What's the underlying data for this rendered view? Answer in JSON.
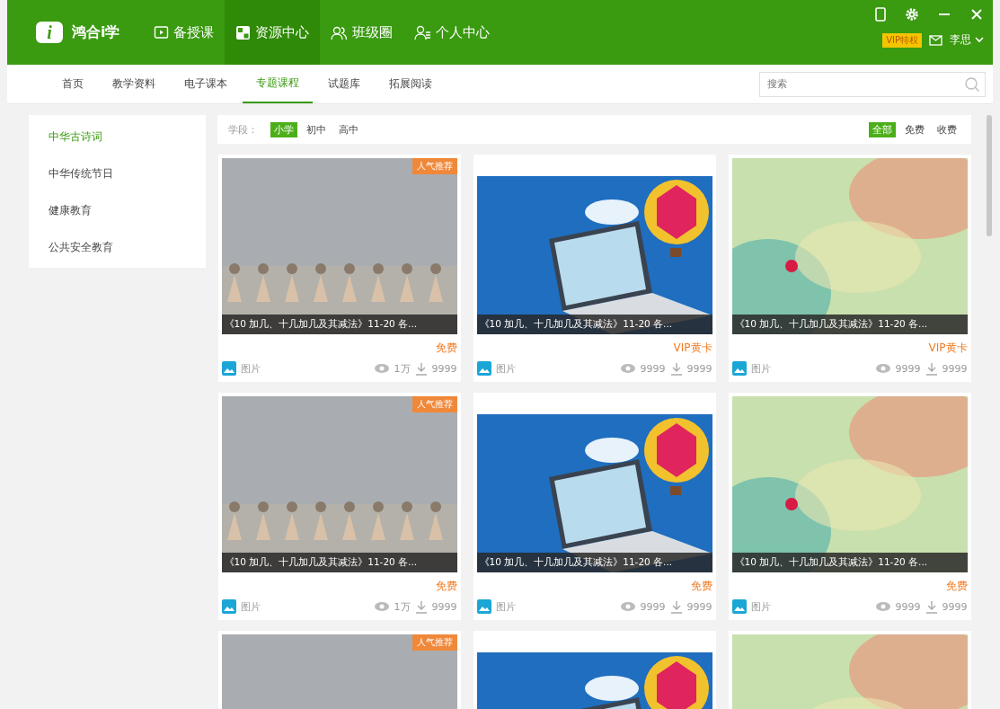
{
  "app": {
    "logo_mark": "i",
    "name": "鸿合i学",
    "vip": "VIP特权",
    "user": "李思"
  },
  "nav": [
    {
      "label": "备授课",
      "selected": false
    },
    {
      "label": "资源中心",
      "selected": true
    },
    {
      "label": "班级圈",
      "selected": false
    },
    {
      "label": "个人中心",
      "selected": false
    }
  ],
  "subnav": [
    {
      "label": "首页",
      "selected": false
    },
    {
      "label": "教学资料",
      "selected": false
    },
    {
      "label": "电子课本",
      "selected": false
    },
    {
      "label": "专题课程",
      "selected": true
    },
    {
      "label": "试题库",
      "selected": false
    },
    {
      "label": "拓展阅读",
      "selected": false
    }
  ],
  "search": {
    "placeholder": "搜索"
  },
  "sidebar": {
    "items": [
      {
        "label": "中华古诗词",
        "selected": true
      },
      {
        "label": "中华传统节日",
        "selected": false
      },
      {
        "label": "健康教育",
        "selected": false
      },
      {
        "label": "公共安全教育",
        "selected": false
      }
    ]
  },
  "filter": {
    "label": "学段：",
    "stages": [
      {
        "label": "小学",
        "selected": true
      },
      {
        "label": "初中",
        "selected": false
      },
      {
        "label": "高中",
        "selected": false
      }
    ],
    "prices": [
      {
        "label": "全部",
        "selected": true
      },
      {
        "label": "免费",
        "selected": false
      },
      {
        "label": "收费",
        "selected": false
      }
    ]
  },
  "cards": [
    {
      "kind": "picture",
      "badge": "人气推荐",
      "title": "《10 加几、十几加几及其减法》11-20 各...",
      "price": "免费",
      "type": "图片",
      "views": "1万",
      "downloads": "9999"
    },
    {
      "kind": "picture",
      "title": "《10 加几、十几加几及其减法》11-20 各...",
      "price": "VIP黄卡",
      "type": "图片",
      "views": "9999",
      "downloads": "9999"
    },
    {
      "kind": "picture",
      "title": "《10 加几、十几加几及其减法》11-20 各...",
      "price": "VIP黄卡",
      "type": "图片",
      "views": "9999",
      "downloads": "9999"
    },
    {
      "kind": "picture",
      "badge": "人气推荐",
      "title": "《10 加几、十几加几及其减法》11-20 各...",
      "price": "免费",
      "type": "图片",
      "views": "1万",
      "downloads": "9999"
    },
    {
      "kind": "picture",
      "title": "《10 加几、十几加几及其减法》11-20 各...",
      "price": "免费",
      "type": "图片",
      "views": "9999",
      "downloads": "9999"
    },
    {
      "kind": "picture",
      "title": "《10 加几、十几加几及其减法》11-20 各...",
      "price": "免费",
      "type": "图片",
      "views": "9999",
      "downloads": "9999"
    },
    {
      "kind": "picture",
      "badge": "人气推荐"
    },
    {
      "kind": "picture"
    },
    {
      "kind": "picture"
    }
  ]
}
